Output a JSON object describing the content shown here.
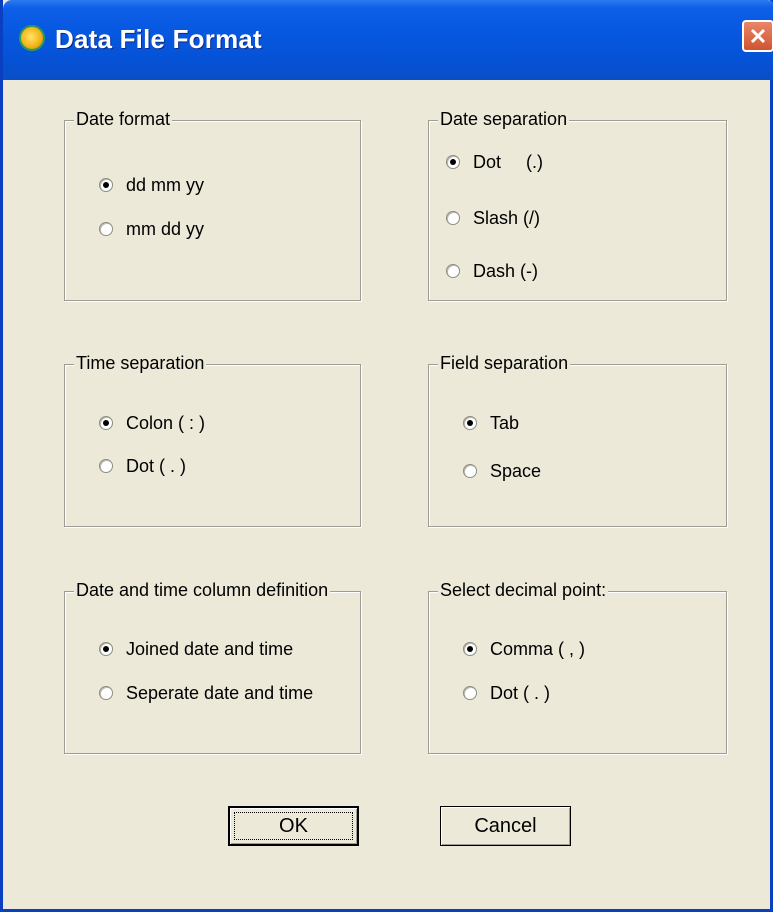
{
  "window": {
    "title": "Data File Format"
  },
  "groups": {
    "date_format": {
      "label": "Date format",
      "options": [
        "dd mm yy",
        "mm dd yy"
      ],
      "selected": 0
    },
    "date_separation": {
      "label": "Date separation",
      "options": [
        "Dot     (.)",
        "Slash (/)",
        "Dash (-)"
      ],
      "selected": 0
    },
    "time_separation": {
      "label": "Time separation",
      "options": [
        "Colon ( : )",
        "Dot ( . )"
      ],
      "selected": 0
    },
    "field_separation": {
      "label": "Field separation",
      "options": [
        "Tab",
        "Space"
      ],
      "selected": 0
    },
    "datetime_column": {
      "label": "Date and time column definition",
      "options": [
        "Joined date and time",
        "Seperate date and time"
      ],
      "selected": 0
    },
    "decimal_point": {
      "label": "Select decimal point:",
      "options": [
        "Comma ( , )",
        "Dot ( . )"
      ],
      "selected": 0
    }
  },
  "buttons": {
    "ok": "OK",
    "cancel": "Cancel"
  }
}
